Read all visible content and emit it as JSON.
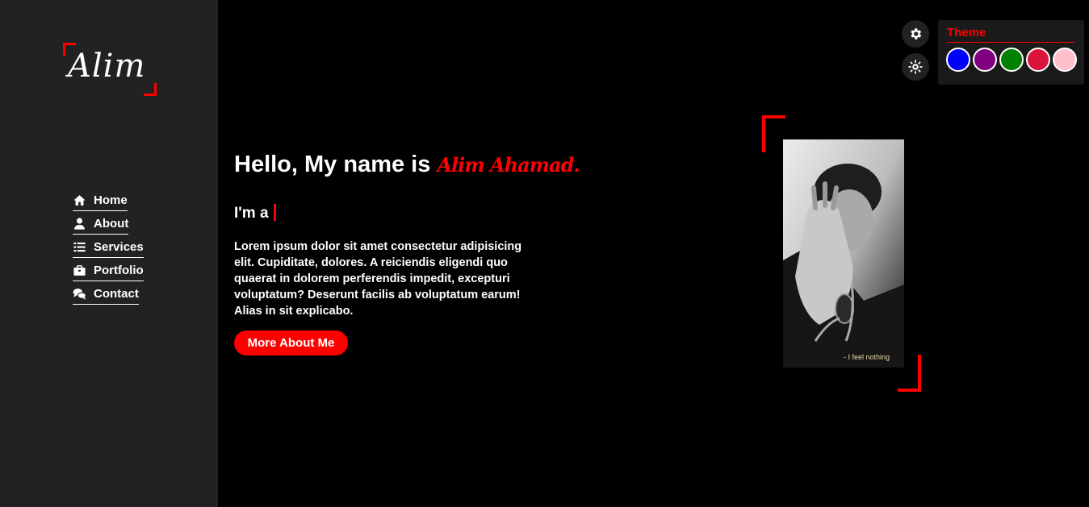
{
  "logo": {
    "text": "Alim"
  },
  "nav": [
    {
      "label": "Home",
      "icon": "home-icon"
    },
    {
      "label": "About",
      "icon": "user-icon"
    },
    {
      "label": "Services",
      "icon": "list-icon"
    },
    {
      "label": "Portfolio",
      "icon": "briefcase-icon"
    },
    {
      "label": "Contact",
      "icon": "comments-icon"
    }
  ],
  "hero": {
    "greeting": "Hello, My name is ",
    "name": "Alim Ahamad.",
    "typing_prefix": "I'm a",
    "description": "Lorem ipsum dolor sit amet consectetur adipisicing elit. Cupiditate, dolores. A reiciendis eligendi quo quaerat in dolorem perferendis impedit, excepturi voluptatum? Deserunt facilis ab voluptatum earum! Alias in sit explicabo.",
    "button_label": "More About Me"
  },
  "photo": {
    "caption": "- I feel nothing"
  },
  "controls": {
    "settings_icon": "gear-icon",
    "mode_icon": "sun-icon"
  },
  "theme": {
    "title": "Theme",
    "colors": [
      "#0000ff",
      "#800080",
      "#008000",
      "#dc143c",
      "#ffc0cb"
    ]
  },
  "accent": "#ff0000"
}
